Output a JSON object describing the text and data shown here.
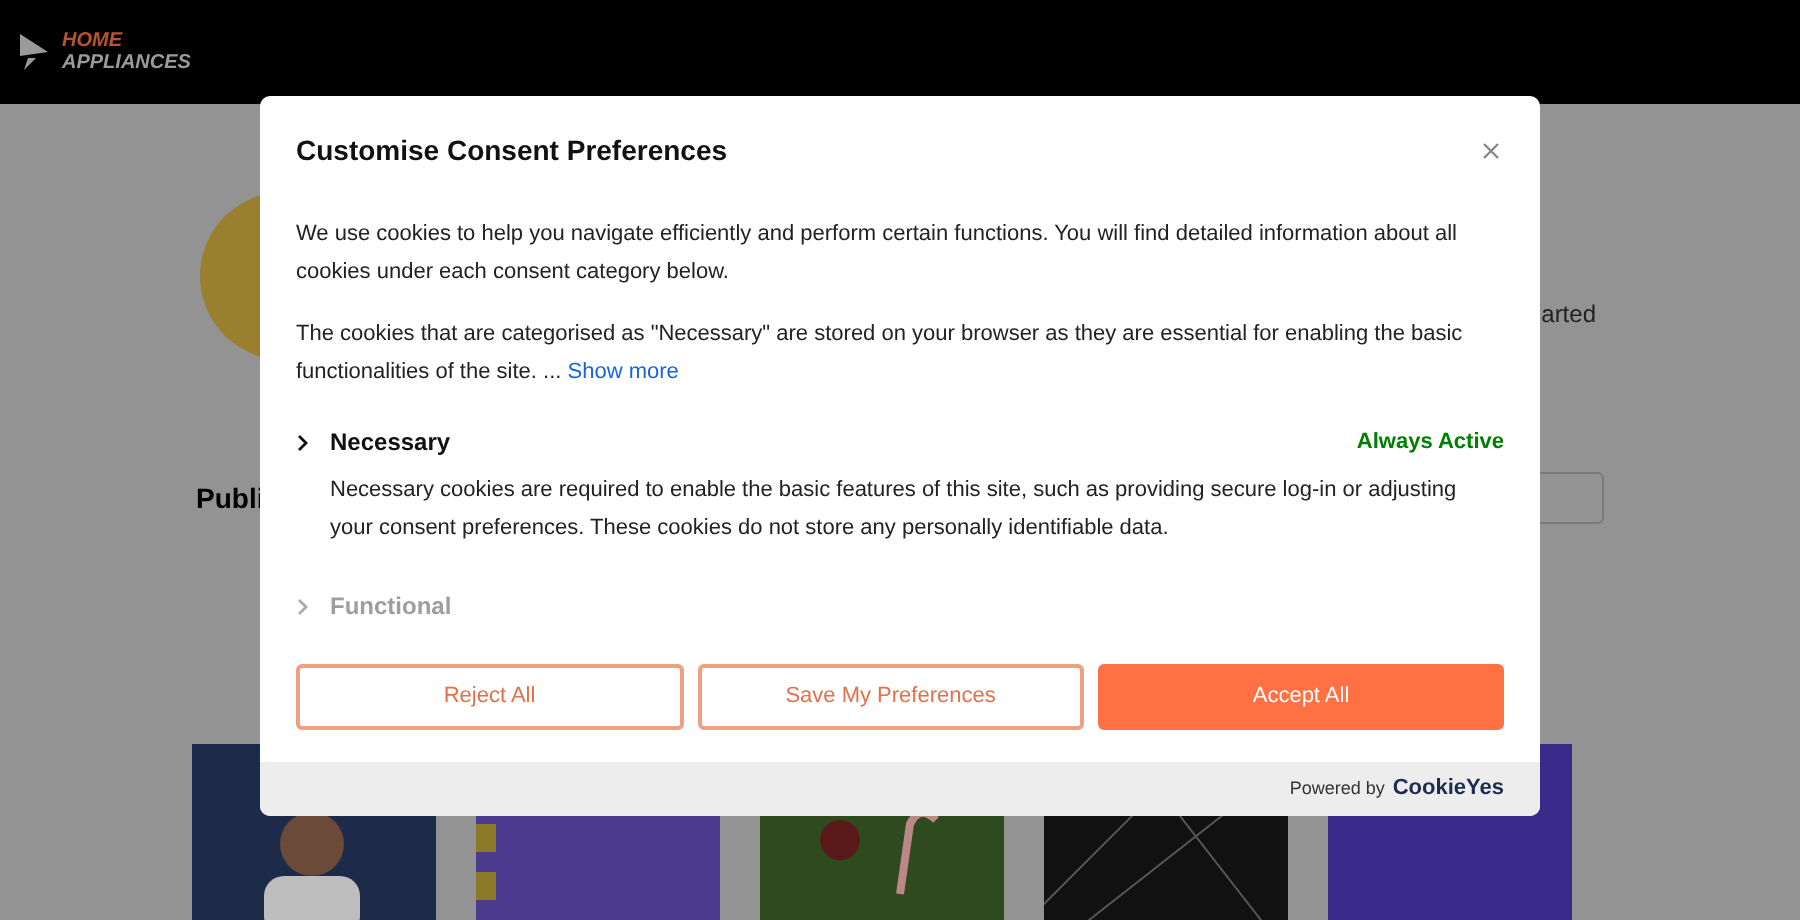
{
  "header": {
    "logo_top": "HOME",
    "logo_bottom": "APPLIANCES"
  },
  "background": {
    "side_text": "arted",
    "section_title": "Publi"
  },
  "modal": {
    "title": "Customise Consent Preferences",
    "intro": "We use cookies to help you navigate efficiently and perform certain functions. You will find detailed information about all cookies under each consent category below.",
    "necessary_note": "The cookies that are categorised as \"Necessary\" are stored on your browser as they are essential for enabling the basic functionalities of the site. ...",
    "show_more": "Show more",
    "categories": [
      {
        "name": "Necessary",
        "status": "Always Active",
        "description": "Necessary cookies are required to enable the basic features of this site, such as providing secure log-in or adjusting your consent preferences. These cookies do not store any personally identifiable data."
      },
      {
        "name": "Functional"
      }
    ],
    "buttons": [
      {
        "label": "Reject All",
        "kind": "outline"
      },
      {
        "label": "Save My Preferences",
        "kind": "outline"
      },
      {
        "label": "Accept All",
        "kind": "filled"
      }
    ],
    "footer": {
      "powered_by": "Powered by",
      "brand": "CookieYes"
    }
  }
}
